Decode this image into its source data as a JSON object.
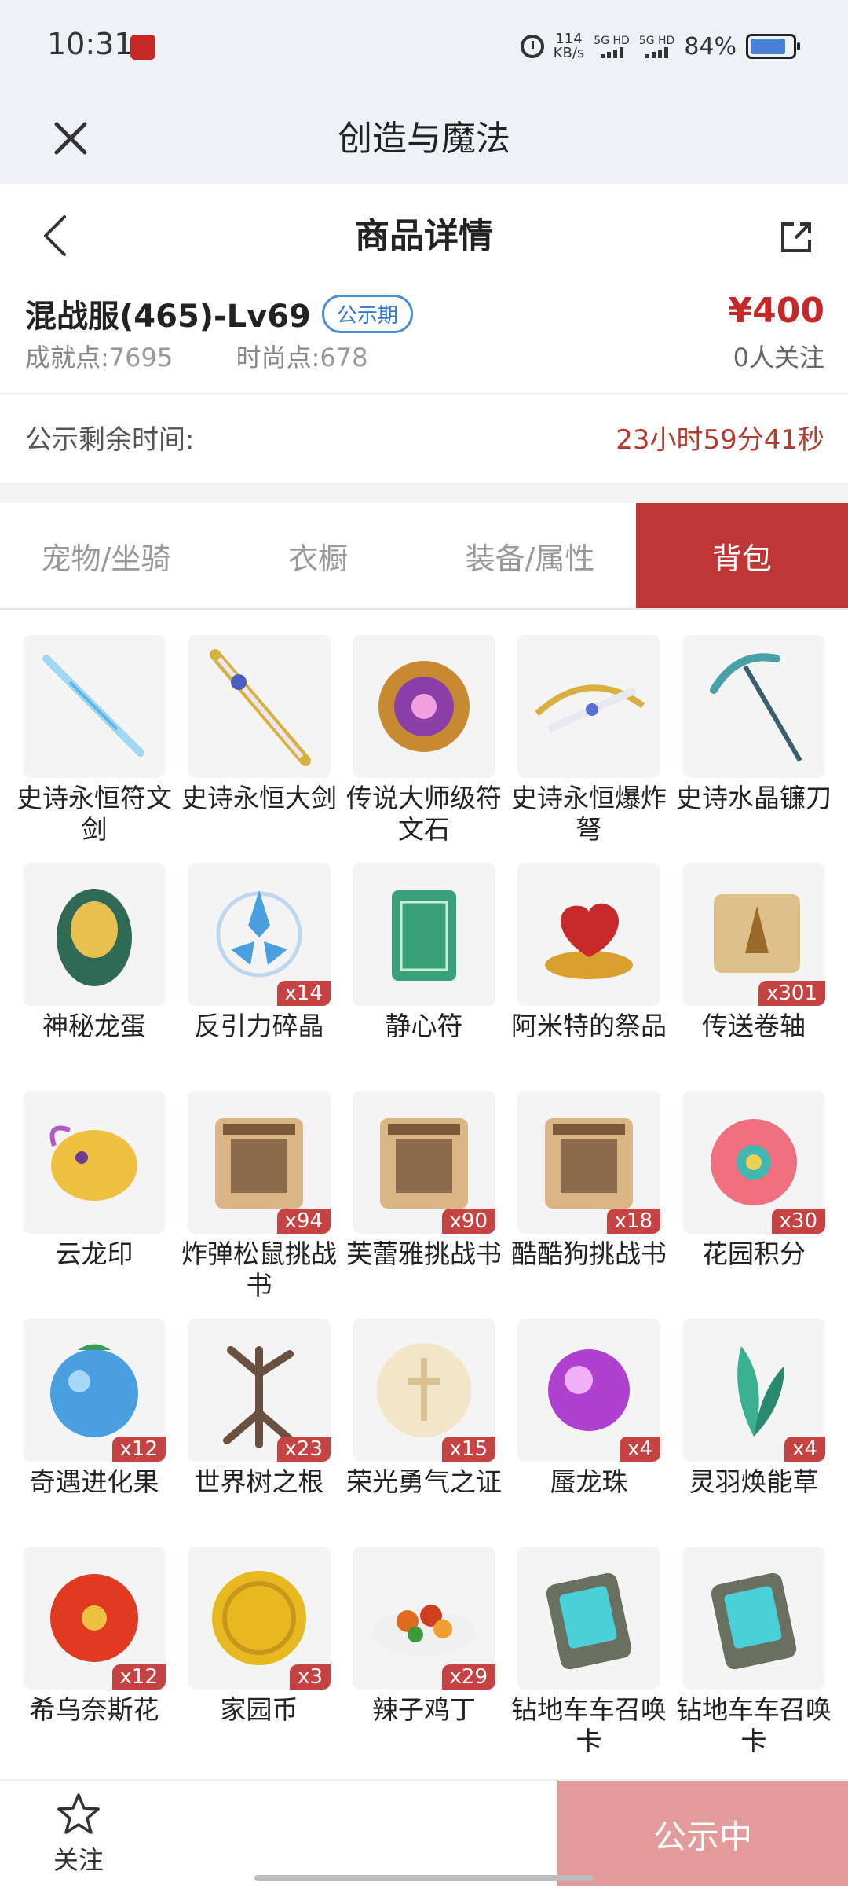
{
  "status_bar": {
    "time": "10:31",
    "net_speed_value": "114",
    "net_speed_unit": "KB/s",
    "sim1": "5G HD",
    "sim2": "5G HD",
    "battery": "84%"
  },
  "app": {
    "title": "创造与魔法"
  },
  "detail": {
    "title": "商品详情"
  },
  "product": {
    "name": "混战服(465)-Lv69",
    "badge": "公示期",
    "achievement_label": "成就点:",
    "achievement_value": "7695",
    "fashion_label": "时尚点:",
    "fashion_value": "678",
    "price": "¥400",
    "followers": "0人关注"
  },
  "countdown": {
    "label": "公示剩余时间:",
    "value": "23小时59分41秒"
  },
  "tabs": [
    {
      "label": "宠物/坐骑",
      "active": false
    },
    {
      "label": "衣橱",
      "active": false
    },
    {
      "label": "装备/属性",
      "active": false
    },
    {
      "label": "背包",
      "active": true
    }
  ],
  "items": [
    {
      "name": "史诗永恒符文剑",
      "qty": "",
      "icon": "crystal-sword"
    },
    {
      "name": "史诗永恒大剑",
      "qty": "",
      "icon": "great-sword"
    },
    {
      "name": "传说大师级符文石",
      "qty": "",
      "icon": "rune-stone"
    },
    {
      "name": "史诗永恒爆炸弩",
      "qty": "",
      "icon": "crossbow"
    },
    {
      "name": "史诗水晶镰刀",
      "qty": "",
      "icon": "scythe"
    },
    {
      "name": "神秘龙蛋",
      "qty": "",
      "icon": "dragon-egg"
    },
    {
      "name": "反引力碎晶",
      "qty": "x14",
      "icon": "antigravity-shard"
    },
    {
      "name": "静心符",
      "qty": "",
      "icon": "talisman"
    },
    {
      "name": "阿米特的祭品",
      "qty": "",
      "icon": "heart-offering"
    },
    {
      "name": "传送卷轴",
      "qty": "x301",
      "icon": "teleport-scroll"
    },
    {
      "name": "云龙印",
      "qty": "",
      "icon": "cloud-dragon"
    },
    {
      "name": "炸弹松鼠挑战书",
      "qty": "x94",
      "icon": "wanted-scroll"
    },
    {
      "name": "芙蕾雅挑战书",
      "qty": "x90",
      "icon": "wanted-scroll"
    },
    {
      "name": "酷酷狗挑战书",
      "qty": "x18",
      "icon": "wanted-scroll"
    },
    {
      "name": "花园积分",
      "qty": "x30",
      "icon": "garden-flower"
    },
    {
      "name": "奇遇进化果",
      "qty": "x12",
      "icon": "evolution-fruit"
    },
    {
      "name": "世界树之根",
      "qty": "x23",
      "icon": "tree-root"
    },
    {
      "name": "荣光勇气之证",
      "qty": "x15",
      "icon": "courage-emblem"
    },
    {
      "name": "蜃龙珠",
      "qty": "x4",
      "icon": "dragon-pearl"
    },
    {
      "name": "灵羽焕能草",
      "qty": "x4",
      "icon": "feather-herb"
    },
    {
      "name": "希乌奈斯花",
      "qty": "x12",
      "icon": "red-flower"
    },
    {
      "name": "家园币",
      "qty": "x3",
      "icon": "gold-coin"
    },
    {
      "name": "辣子鸡丁",
      "qty": "x29",
      "icon": "chicken-dish"
    },
    {
      "name": "钻地车车召唤卡",
      "qty": "",
      "icon": "summon-card"
    },
    {
      "name": "钻地车车召唤卡",
      "qty": "",
      "icon": "summon-card"
    }
  ],
  "bottom": {
    "follow_label": "关注",
    "status_label": "公示中"
  },
  "colors": {
    "accent": "#c03535",
    "price": "#c62828",
    "badge": "#2e7bd1",
    "status_button": "#e39a9a"
  }
}
